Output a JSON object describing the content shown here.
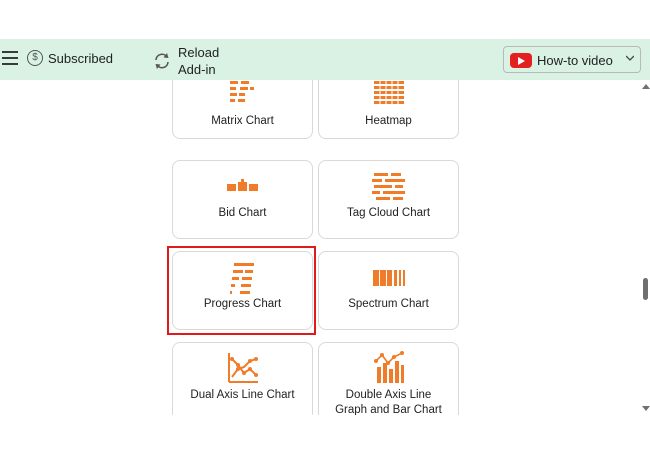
{
  "header": {
    "menu_icon": "hamburger-icon",
    "subscription_icon": "dollar-circle-icon",
    "subscription_label": "Subscribed",
    "reload_icon": "refresh-icon",
    "reload_label_line1": "Reload",
    "reload_label_line2": "Add-in",
    "howto_icon": "youtube-icon",
    "howto_label": "How-to video",
    "howto_chevron": "chevron-down-icon"
  },
  "charts": [
    {
      "label": "Matrix Chart",
      "icon": "matrix-chart-icon"
    },
    {
      "label": "Heatmap",
      "icon": "heatmap-icon"
    },
    {
      "label": "Bid Chart",
      "icon": "bid-chart-icon"
    },
    {
      "label": "Tag Cloud Chart",
      "icon": "tag-cloud-chart-icon"
    },
    {
      "label": "Progress Chart",
      "icon": "progress-chart-icon",
      "selected": true
    },
    {
      "label": "Spectrum Chart",
      "icon": "spectrum-chart-icon"
    },
    {
      "label": "Dual Axis Line Chart",
      "icon": "dual-axis-line-chart-icon"
    },
    {
      "label_line1": "Double Axis Line",
      "label_line2": "Graph and Bar Chart",
      "icon": "double-axis-line-bar-chart-icon"
    }
  ],
  "colors": {
    "accent": "#f07c2a",
    "header_bg": "#d9f2e3",
    "selection": "#e01a1a"
  }
}
